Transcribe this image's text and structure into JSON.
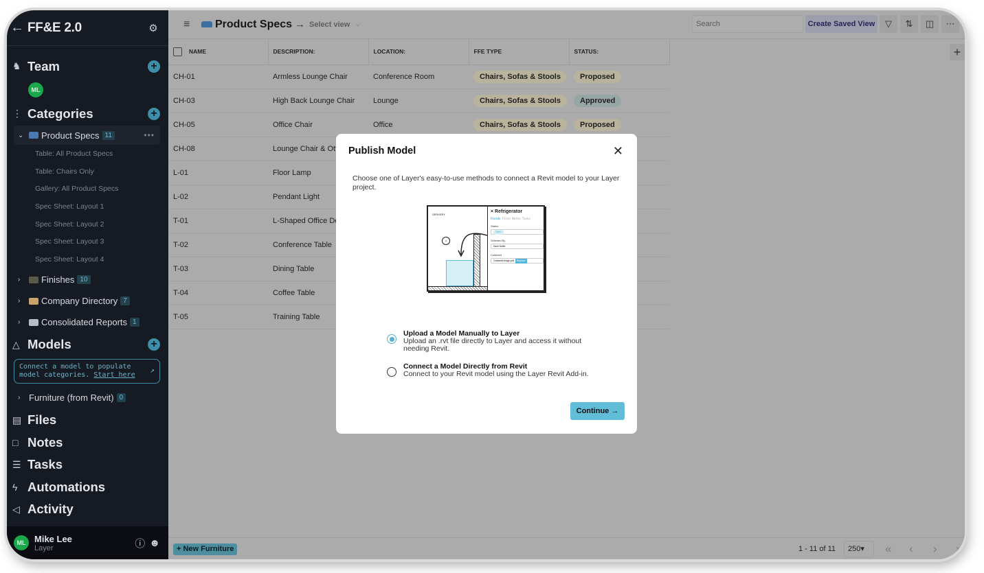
{
  "sidebar": {
    "back_icon": "arrow-left-icon",
    "title": "FF&E 2.0",
    "settings_icon": "gear-icon",
    "team": {
      "label": "Team",
      "members": [
        {
          "initials": "ML",
          "color": "#1aa84a"
        }
      ]
    },
    "categories": {
      "label": "Categories",
      "items": [
        {
          "label": "Product Specs",
          "count": "11",
          "expanded": true,
          "views": [
            "Table: All Product Specs",
            "Table: Chairs Only",
            "Gallery: All Product Specs",
            "Spec Sheet: Layout 1",
            "Spec Sheet: Layout 2",
            "Spec Sheet: Layout 3",
            "Spec Sheet: Layout 4"
          ]
        },
        {
          "label": "Finishes",
          "count": "10"
        },
        {
          "label": "Company Directory",
          "count": "7"
        },
        {
          "label": "Consolidated Reports",
          "count": "1"
        }
      ]
    },
    "models": {
      "label": "Models",
      "prompt_text": "Connect a model to populate model categories.",
      "prompt_link": "Start here",
      "items": [
        {
          "label": "Furniture (from Revit)",
          "count": "0"
        }
      ]
    },
    "nav": [
      {
        "label": "Files",
        "icon": "file-icon"
      },
      {
        "label": "Notes",
        "icon": "chat-icon"
      },
      {
        "label": "Tasks",
        "icon": "checklist-icon"
      },
      {
        "label": "Automations",
        "icon": "bolt-icon"
      },
      {
        "label": "Activity",
        "icon": "megaphone-icon"
      }
    ],
    "user": {
      "initials": "ML",
      "name": "Mike Lee",
      "org": "Layer"
    }
  },
  "topbar": {
    "title": "Product Specs",
    "select_view": "Select view",
    "search_placeholder": "Search",
    "create_saved_view": "Create Saved View"
  },
  "table": {
    "columns": [
      "NAME",
      "DESCRIPTION:",
      "LOCATION:",
      "FFE TYPE",
      "STATUS:"
    ],
    "rows": [
      {
        "name": "CH-01",
        "description": "Armless Lounge Chair",
        "location": "Conference Room",
        "type": "Chairs, Sofas & Stools",
        "status": "Proposed"
      },
      {
        "name": "CH-03",
        "description": "High Back Lounge Chair",
        "location": "Lounge",
        "type": "Chairs, Sofas & Stools",
        "status": "Approved"
      },
      {
        "name": "CH-05",
        "description": "Office Chair",
        "location": "Office",
        "type": "Chairs, Sofas & Stools",
        "status": "Proposed"
      },
      {
        "name": "CH-08",
        "description": "Lounge Chair & Otto",
        "location": "",
        "type": "",
        "status": ""
      },
      {
        "name": "L-01",
        "description": "Floor Lamp",
        "location": "",
        "type": "",
        "status": ""
      },
      {
        "name": "L-02",
        "description": "Pendant Light",
        "location": "",
        "type": "",
        "status": ""
      },
      {
        "name": "T-01",
        "description": "L-Shaped Office Desk",
        "location": "",
        "type": "",
        "status": ""
      },
      {
        "name": "T-02",
        "description": "Conference Table",
        "location": "",
        "type": "",
        "status": ""
      },
      {
        "name": "T-03",
        "description": "Dining Table",
        "location": "",
        "type": "",
        "status": ""
      },
      {
        "name": "T-04",
        "description": "Coffee Table",
        "location": "",
        "type": "",
        "status": ""
      },
      {
        "name": "T-05",
        "description": "Training Table",
        "location": "",
        "type": "",
        "status": ""
      }
    ]
  },
  "footer": {
    "new_button": "+ New Furniture",
    "range": "1 - 11 of 11",
    "page_size": "250"
  },
  "modal": {
    "title": "Publish Model",
    "description": "Choose one of Layer's easy-to-use methods to connect a Revit model to your Layer project.",
    "illustration": {
      "panel_title": "Refrigerator",
      "tabs": [
        "Fields",
        "Files",
        "Notes",
        "Tasks"
      ],
      "status_label": "Status",
      "status_value": "Open",
      "selected_by_label": "Selected By",
      "selected_by_value": "Zach Soflin",
      "cutsheet_label": "Cutsheet",
      "cutsheet_file": "Cutsheet-fridge.pdf",
      "replace": "Replace",
      "room_label": "SERVERY",
      "room_tag": "REF"
    },
    "options": [
      {
        "title": "Upload a Model Manually to Layer",
        "desc": "Upload an .rvt file directly to Layer and access it without needing Revit.",
        "selected": true
      },
      {
        "title": "Connect a Model Directly from Revit",
        "desc": "Connect to your Revit model using the Layer Revit Add-in.",
        "selected": false
      }
    ],
    "continue": "Continue →"
  }
}
